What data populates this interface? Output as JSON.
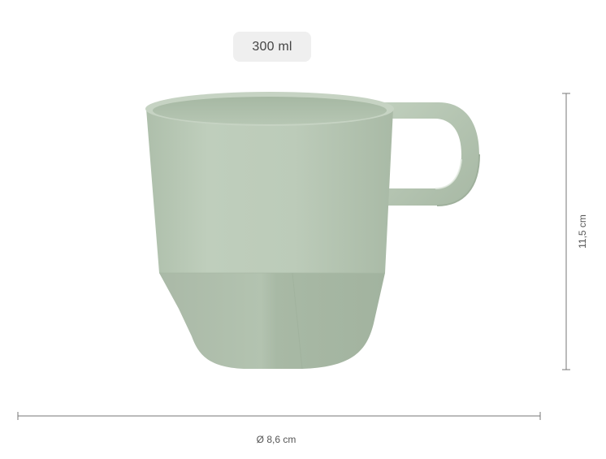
{
  "capacity": {
    "label": "300 ml"
  },
  "dimensions": {
    "height_label": "11,5 cm",
    "diameter_label": "Ø 8,6 cm"
  },
  "product": {
    "type": "mug",
    "color": "#b9c9b6"
  },
  "colors": {
    "mug_body": "#b9c9b6",
    "mug_shadow": "#a9bba6",
    "mug_inner": "#aebfab",
    "dimension_line": "#777777",
    "badge_background": "#efefef"
  }
}
